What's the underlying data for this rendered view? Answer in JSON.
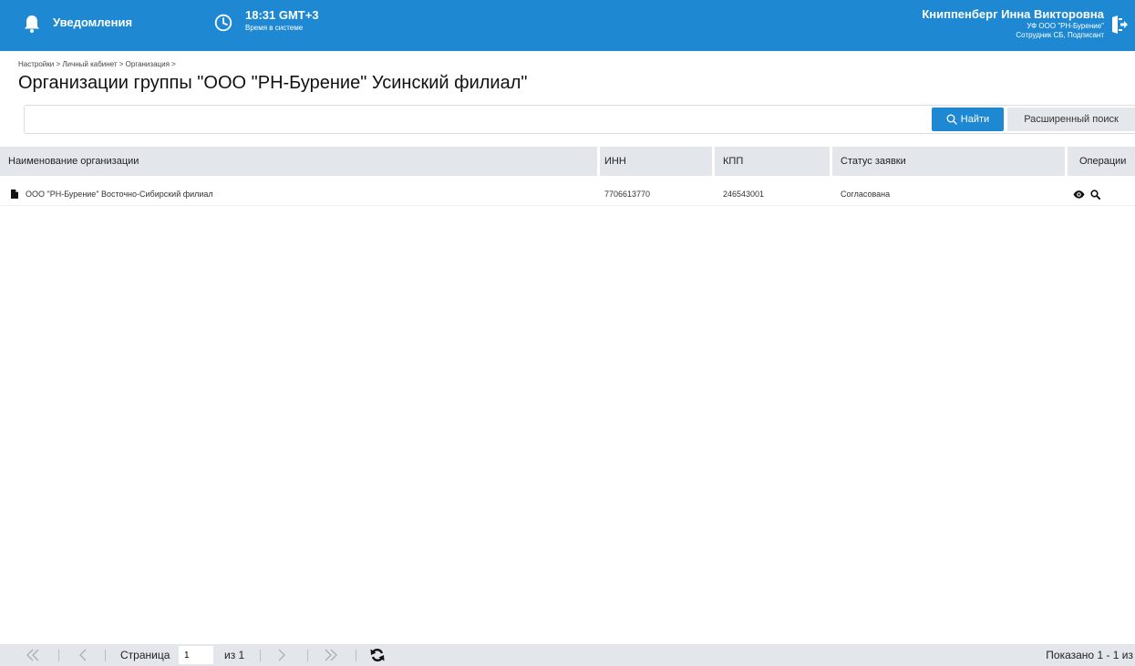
{
  "header": {
    "notifications_label": "Уведомления",
    "time": "18:31 GMT+3",
    "time_caption": "Время в системе",
    "user_name": "Книппенберг Инна Викторовна",
    "user_org": "УФ ООО \"РН-Бурение\"",
    "user_role": "Сотрудник СБ, Подписант"
  },
  "breadcrumb": "Настройки > Личный кабинет > Организация >",
  "page_title": "Организации группы \"ООО \"РН-Бурение\" Усинский филиал\"",
  "search": {
    "value": "",
    "find_label": "Найти",
    "advanced_label": "Расширенный поиск"
  },
  "table": {
    "columns": [
      "Наименование организации",
      "ИНН",
      "КПП",
      "Статус заявки",
      "Операции"
    ],
    "rows": [
      {
        "name": "ООО \"РН-Бурение\" Восточно-Сибирский филиал",
        "inn": "7706613770",
        "kpp": "246543001",
        "status": "Согласована"
      }
    ]
  },
  "pager": {
    "page_label": "Страница",
    "page_value": "1",
    "of_label": "из 1",
    "shown_label": "Показано 1 - 1 из"
  },
  "icons": {
    "notifications": "bell-icon",
    "clock": "clock-icon",
    "logout": "logout-icon",
    "search": "search-icon",
    "document": "document-icon",
    "view": "eye-icon",
    "zoom": "magnifier-icon",
    "refresh": "refresh-icon"
  },
  "colors": {
    "header_bg": "#1e88d2",
    "primary_button": "#1e88d2",
    "table_header_bg": "#e3e7ec"
  }
}
